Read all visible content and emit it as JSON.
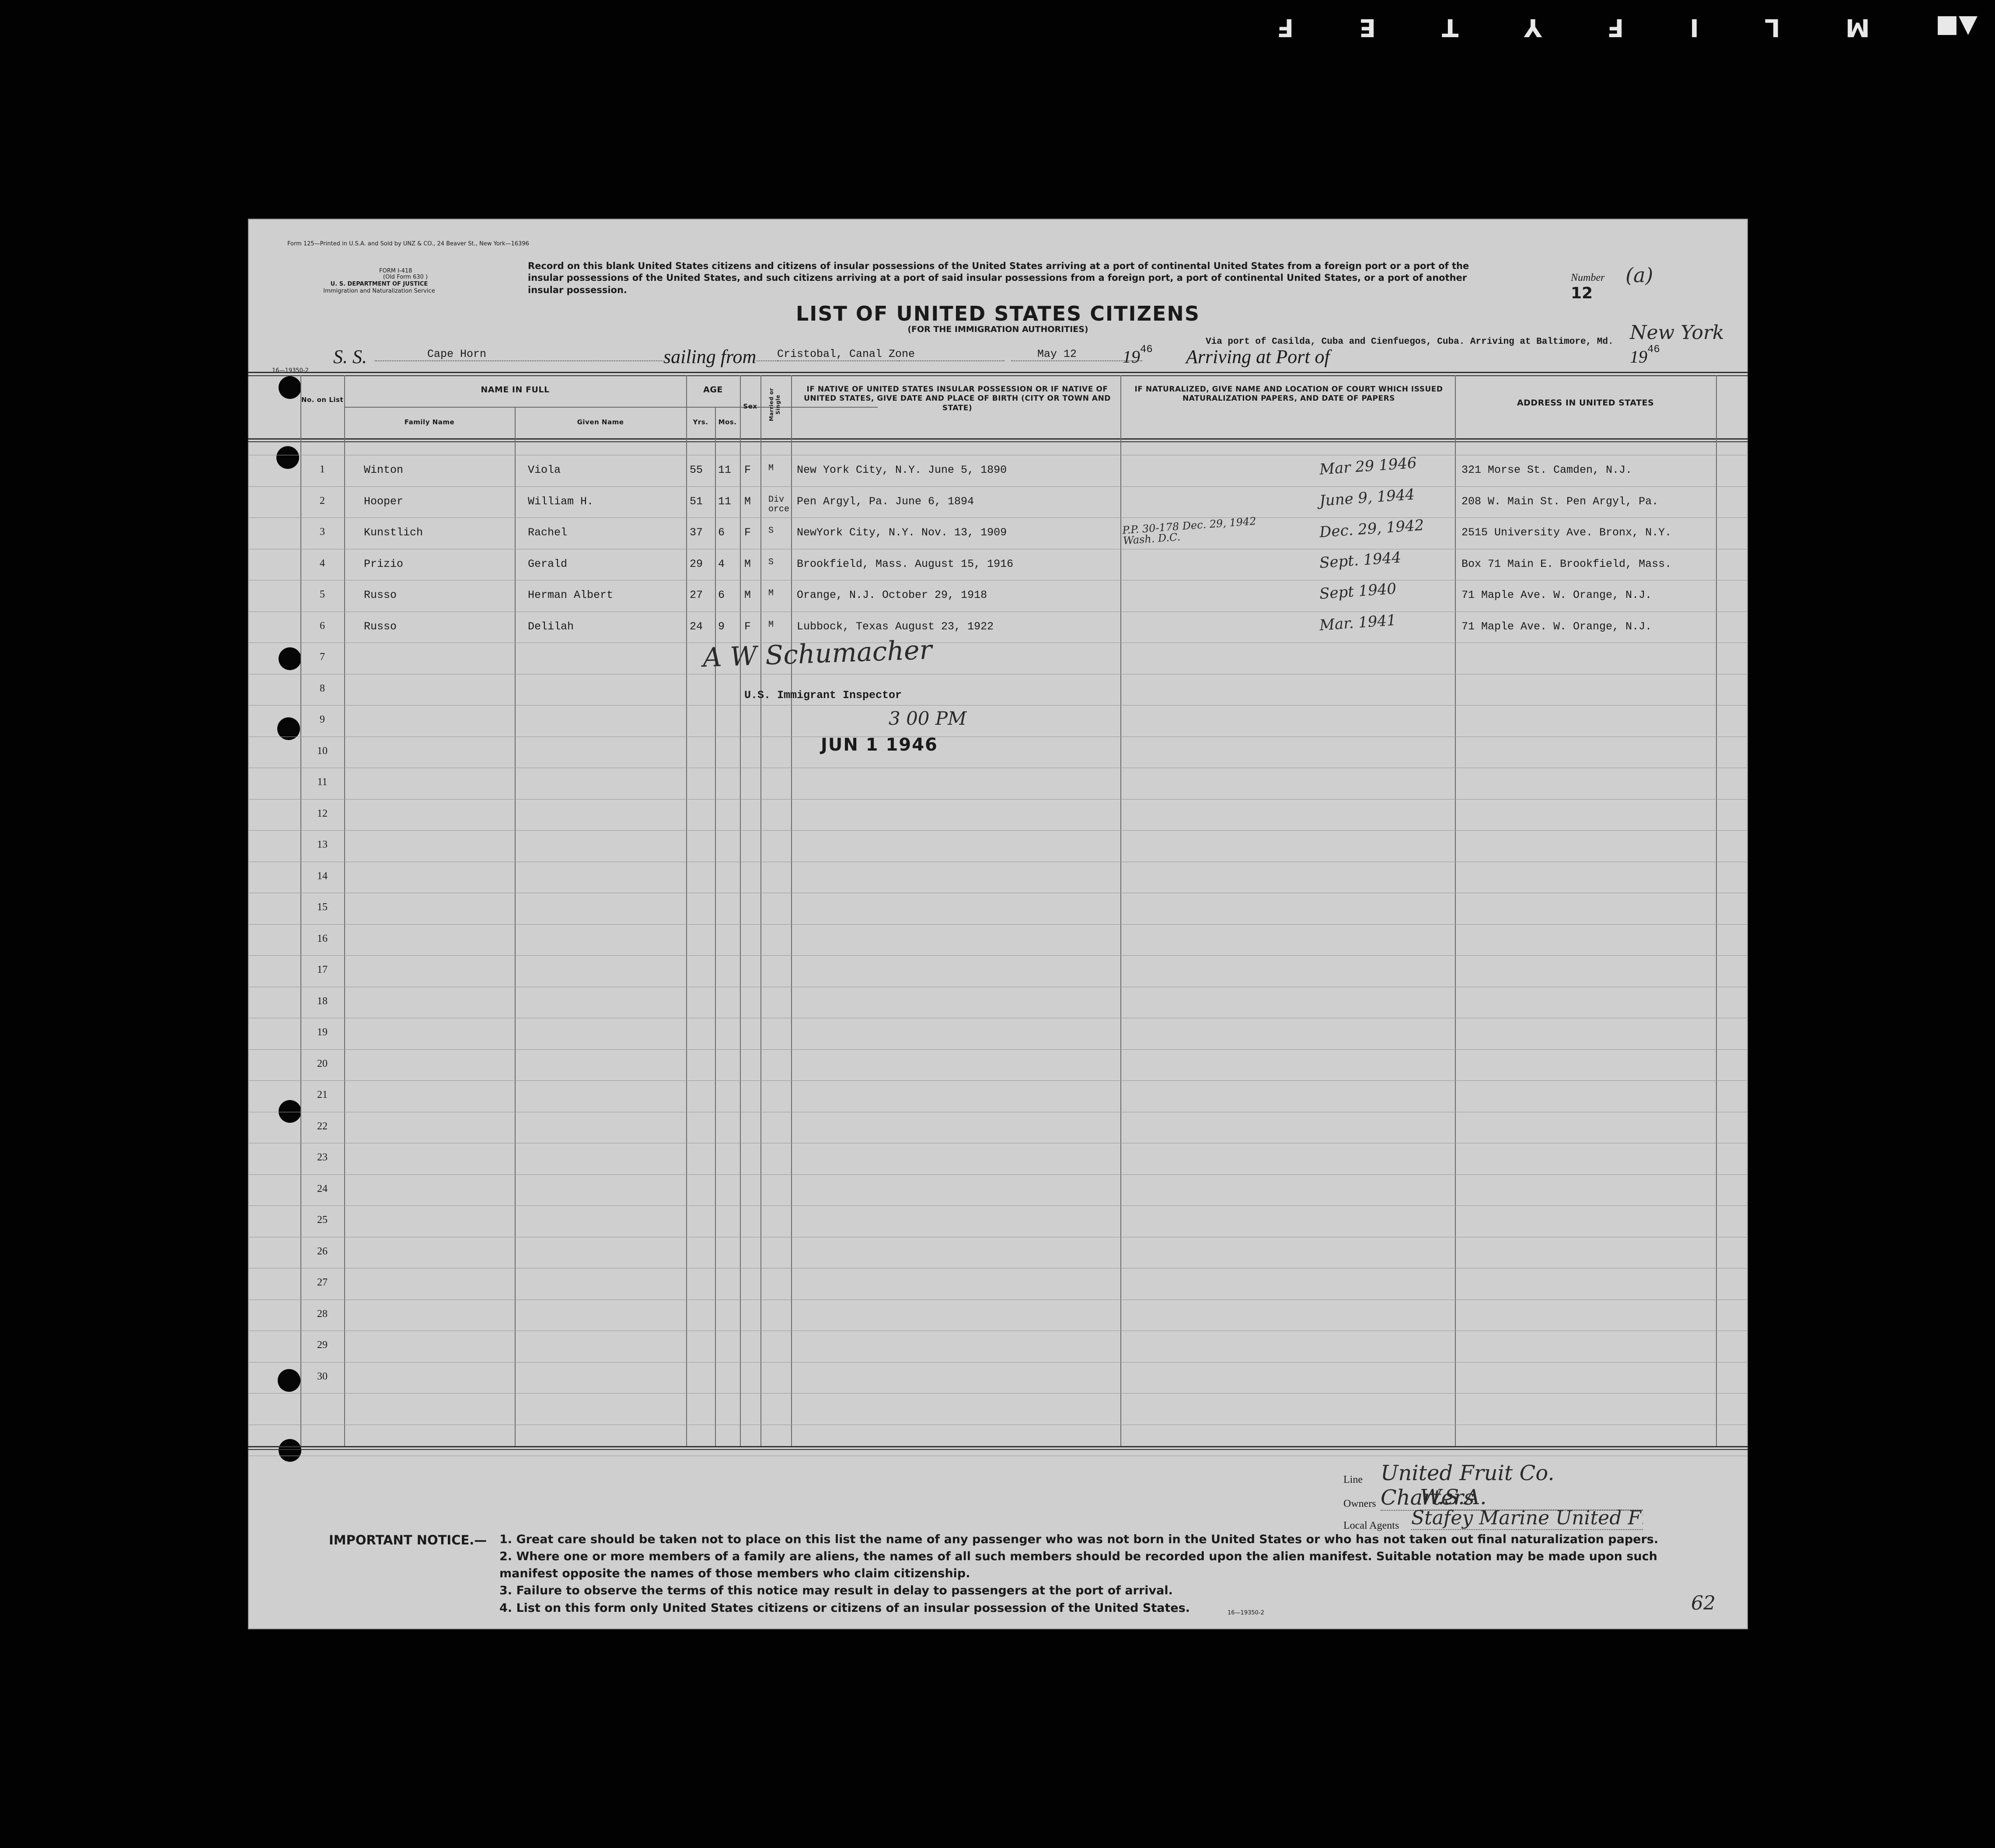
{
  "film_edge": [
    "F",
    "E",
    "T",
    "Y",
    "F",
    "I",
    "L",
    "M",
    "▲■"
  ],
  "form": {
    "printer_line": "Form 125—Printed in U.S.A. and Sold by UNZ & CO., 24 Beaver St., New York—16396",
    "form_no": "FORM I-418",
    "old_form": "(Old Form 630 )",
    "department": "U. S. DEPARTMENT OF JUSTICE",
    "service": "Immigration and Naturalization Service",
    "instructions": "Record on this blank United States citizens and citizens of insular possessions of the United States arriving at a port of continental United States from a foreign port or a port of the insular possessions of the United States, and such citizens arriving at a port of said insular possessions from a foreign port, a port of continental United States, or a port of another insular possession.",
    "title": "LIST OF UNITED STATES CITIZENS",
    "subtitle": "(FOR THE IMMIGRATION AUTHORITIES)",
    "number_label": "Number",
    "number_hand": "(a)",
    "number_value": "12",
    "margin_code": "16—19350-2",
    "footer_code": "16—19350-2",
    "page_mark": "62"
  },
  "voyage": {
    "ss_label": "S. S.",
    "ship": "Cape Horn",
    "sailing_label": "sailing from",
    "from": "Cristobal, Canal Zone",
    "date": "May 12",
    "year_prefix": "19",
    "year_suffix": "46",
    "arriving_label": "Arriving at Port of",
    "via": "Via port of Casilda, Cuba and Cienfuegos, Cuba. Arriving at Baltimore, Md.",
    "port_hand": "New York",
    "year2_prefix": "19",
    "year2_suffix": "46"
  },
  "columns": {
    "no_on_list": "No. on List",
    "name_in_full": "NAME IN FULL",
    "family_name": "Family Name",
    "given_name": "Given Name",
    "age": "AGE",
    "yrs": "Yrs.",
    "mos": "Mos.",
    "sex": "Sex",
    "married": "Married or Single",
    "birth": "IF NATIVE OF UNITED STATES INSULAR POSSESSION OR IF NATIVE OF UNITED STATES, GIVE DATE AND PLACE OF BIRTH (CITY OR TOWN AND STATE)",
    "naturalized": "IF NATURALIZED, GIVE NAME AND LOCATION OF COURT WHICH ISSUED NATURALIZATION PAPERS, AND DATE OF PAPERS",
    "address": "ADDRESS IN UNITED STATES"
  },
  "rows": [
    {
      "no": "1",
      "family": "Winton",
      "given": "Viola",
      "yrs": "55",
      "mos": "11",
      "sex": "F",
      "marital": "M",
      "birth": "New York City, N.Y.   June 5, 1890",
      "nat": "",
      "hand": "Mar 29 1946",
      "address": "321 Morse St.   Camden, N.J."
    },
    {
      "no": "2",
      "family": "Hooper",
      "given": "William H.",
      "yrs": "51",
      "mos": "11",
      "sex": "M",
      "marital": "Div orce",
      "birth": "Pen Argyl, Pa.    June 6, 1894",
      "nat": "",
      "hand": "June 9, 1944",
      "address": "208 W. Main St. Pen Argyl, Pa."
    },
    {
      "no": "3",
      "family": "Kunstlich",
      "given": "Rachel",
      "yrs": "37",
      "mos": "6",
      "sex": "F",
      "marital": "S",
      "birth": "NewYork City, N.Y.  Nov. 13, 1909",
      "nat": "P.P. 30-178  Dec. 29, 1942  Wash. D.C.",
      "hand": "Dec. 29, 1942",
      "address": "2515 University Ave. Bronx, N.Y."
    },
    {
      "no": "4",
      "family": "Prizio",
      "given": "Gerald",
      "yrs": "29",
      "mos": "4",
      "sex": "M",
      "marital": "S",
      "birth": "Brookfield, Mass.  August 15, 1916",
      "nat": "",
      "hand": "Sept. 1944",
      "address": "Box 71  Main   E. Brookfield, Mass."
    },
    {
      "no": "5",
      "family": "Russo",
      "given": "Herman Albert",
      "yrs": "27",
      "mos": "6",
      "sex": "M",
      "marital": "M",
      "birth": "Orange, N.J.  October 29, 1918",
      "nat": "",
      "hand": "Sept 1940",
      "address": "71 Maple Ave.  W. Orange, N.J."
    },
    {
      "no": "6",
      "family": "Russo",
      "given": "Delilah",
      "yrs": "24",
      "mos": "9",
      "sex": "F",
      "marital": "M",
      "birth": "Lubbock, Texas  August 23, 1922",
      "nat": "",
      "hand": "Mar. 1941",
      "address": "71 Maple Ave.  W. Orange, N.J."
    }
  ],
  "row_numbers": [
    "1",
    "2",
    "3",
    "4",
    "5",
    "6",
    "7",
    "8",
    "9",
    "10",
    "11",
    "12",
    "13",
    "14",
    "15",
    "16",
    "17",
    "18",
    "19",
    "20",
    "21",
    "22",
    "23",
    "24",
    "25",
    "26",
    "27",
    "28",
    "29",
    "30"
  ],
  "signature": {
    "name": "A W Schumacher",
    "title": "U.S. Immigrant Inspector",
    "time": "3 00 PM",
    "stamp": "JUN 1 1946"
  },
  "agents": {
    "line_label": "Line",
    "line_value": "United Fruit Co. Charters",
    "owners_label": "Owners",
    "owners_value": "W.S.A.",
    "local_label": "Local Agents",
    "local_value": "Stafey Marine  United Fruit Co."
  },
  "notice": {
    "heading": "IMPORTANT NOTICE.—",
    "items": [
      "1. Great care should be taken not to place on this list the name of any passenger who was not born in the United States or who has not taken out final naturalization papers.",
      "2. Where one or more members of a family are aliens, the names of all such members should be recorded upon the alien manifest. Suitable notation may be made upon such manifest opposite the names of those members who claim citizenship.",
      "3. Failure to observe the terms of this notice may result in delay to passengers at the port of arrival.",
      "4. List on this form only United States citizens or citizens of an insular possession of the United States."
    ]
  },
  "colors": {
    "paper": "#cfcfd0",
    "background": "#020202",
    "ink": "#1a1a1a"
  }
}
